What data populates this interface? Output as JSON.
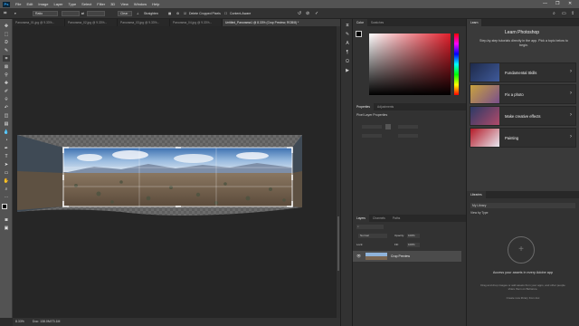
{
  "menu": {
    "logo": "Ps",
    "items": [
      "File",
      "Edit",
      "Image",
      "Layer",
      "Type",
      "Select",
      "Filter",
      "3D",
      "View",
      "Window",
      "Help"
    ],
    "window_controls": [
      "—",
      "❐",
      "✕"
    ]
  },
  "options_bar": {
    "ratio_select": "Ratio",
    "clear_label": "Clear",
    "straighten_label": "Straighten",
    "delete_cropped_label": "Delete Cropped Pixels",
    "content_aware_label": "Content-Aware"
  },
  "tabs": [
    {
      "label": "Panorama_01.jpg @ 9.33%...",
      "active": false
    },
    {
      "label": "Panorama_02.jpg @ 9.33%...",
      "active": false
    },
    {
      "label": "Panorama_03.jpg @ 9.33%...",
      "active": false
    },
    {
      "label": "Panorama_04.jpg @ 9.33%...",
      "active": false
    },
    {
      "label": "Untitled_Panorama1 @ 8.33% (Crop Preview, RGB/8) *",
      "active": true
    }
  ],
  "status_bar": {
    "zoom": "8.33%",
    "doc_info": "Doc: 138.0M/73.1M"
  },
  "color_panel": {
    "tab_label": "Color",
    "swatches_label": "Swatches"
  },
  "properties_panel": {
    "tabs": [
      "Properties",
      "Adjustments"
    ],
    "title": "Pixel Layer Properties"
  },
  "layers_panel": {
    "tabs": [
      "Layers",
      "Channels",
      "Paths"
    ],
    "blend_mode": "Normal",
    "opacity_label": "Opacity:",
    "opacity_value": "100%",
    "fill_label": "Fill:",
    "fill_value": "100%",
    "lock_label": "Lock:",
    "layer_name": "Crop Preview"
  },
  "learn_panel": {
    "tab_label": "Learn",
    "title": "Learn Photoshop",
    "description": "Step-by-step tutorials directly in the app. Pick a topic below to begin.",
    "cards": [
      {
        "label": "Fundamental Skills"
      },
      {
        "label": "Fix a photo"
      },
      {
        "label": "Make creative effects"
      },
      {
        "label": "Painting"
      }
    ]
  },
  "libraries_panel": {
    "tab_label": "Libraries",
    "library_select": "My Library",
    "view_by": "View by Type",
    "empty_title": "Access your assets in every Adobe app",
    "empty_desc": "Drag and drop images or add assets from your apps, and other people share them on Behance.",
    "link": "Create new library from doc"
  }
}
